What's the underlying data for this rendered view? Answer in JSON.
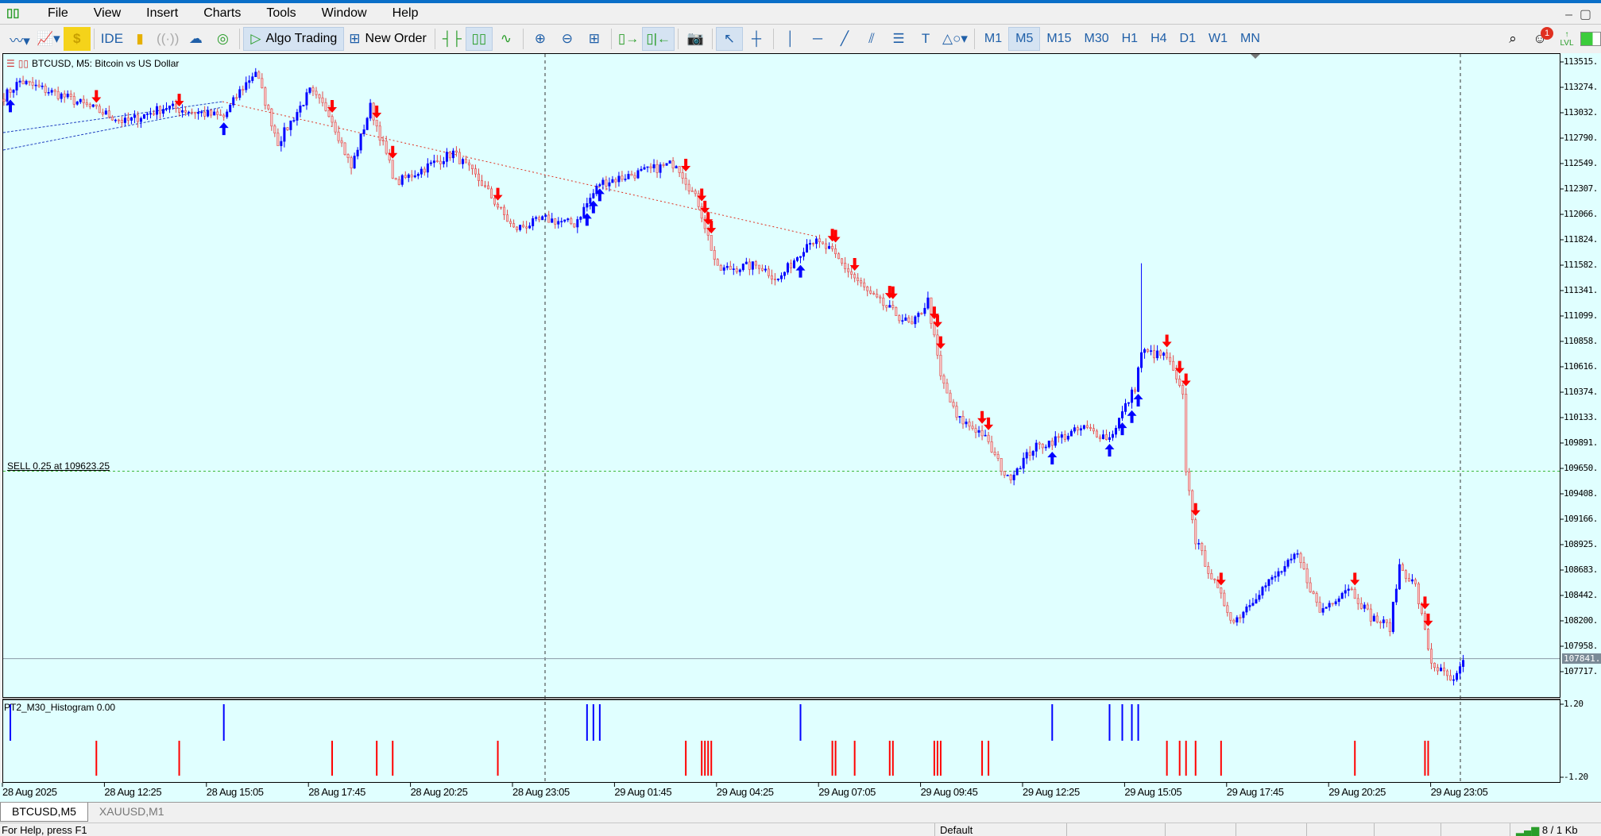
{
  "menu": [
    "File",
    "View",
    "Insert",
    "Charts",
    "Tools",
    "Window",
    "Help"
  ],
  "toolbar": {
    "ide": "IDE",
    "algo_trading": "Algo Trading",
    "new_order": "New Order",
    "timeframes": [
      "M1",
      "M5",
      "M15",
      "M30",
      "H1",
      "H4",
      "D1",
      "W1",
      "MN"
    ],
    "active_timeframe": "M5",
    "notification_count": "1",
    "lvl": "LVL"
  },
  "chart": {
    "title": "BTCUSD, M5:  Bitcoin vs US Dollar",
    "price_ticks": [
      "113515.",
      "113274.",
      "113032.",
      "112790.",
      "112549.",
      "112307.",
      "112066.",
      "111824.",
      "111582.",
      "111341.",
      "111099.",
      "110858.",
      "110616.",
      "110374.",
      "110133.",
      "109891.",
      "109650.",
      "109408.",
      "109166.",
      "108925.",
      "108683.",
      "108442.",
      "108200.",
      "107958.",
      "107717."
    ],
    "price_top": 113515,
    "price_bottom": 107717,
    "current_price": "107841.",
    "current_price_value": 107841,
    "sell_label": "SELL 0.25 at 109623.25",
    "sell_price": 109623.25,
    "time_ticks": [
      "28 Aug 2025",
      "28 Aug 12:25",
      "28 Aug 15:05",
      "28 Aug 17:45",
      "28 Aug 20:25",
      "28 Aug 23:05",
      "29 Aug 01:45",
      "29 Aug 04:25",
      "29 Aug 07:05",
      "29 Aug 09:45",
      "29 Aug 12:25",
      "29 Aug 15:05",
      "29 Aug 17:45",
      "29 Aug 20:25",
      "29 Aug 23:05"
    ],
    "bars_total": 459,
    "close_keypoints": [
      [
        0,
        113185
      ],
      [
        5,
        113331
      ],
      [
        19,
        113185
      ],
      [
        38,
        112943
      ],
      [
        51,
        113088
      ],
      [
        69,
        112991
      ],
      [
        74,
        113234
      ],
      [
        79,
        113428
      ],
      [
        86,
        112749
      ],
      [
        96,
        113234
      ],
      [
        102,
        113040
      ],
      [
        109,
        112506
      ],
      [
        115,
        113088
      ],
      [
        123,
        112361
      ],
      [
        141,
        112652
      ],
      [
        150,
        112361
      ],
      [
        160,
        111924
      ],
      [
        170,
        112021
      ],
      [
        179,
        111973
      ],
      [
        187,
        112361
      ],
      [
        205,
        112506
      ],
      [
        211,
        112555
      ],
      [
        218,
        112167
      ],
      [
        224,
        111536
      ],
      [
        237,
        111585
      ],
      [
        243,
        111439
      ],
      [
        253,
        111827
      ],
      [
        259,
        111730
      ],
      [
        272,
        111294
      ],
      [
        285,
        111003
      ],
      [
        290,
        111245
      ],
      [
        294,
        110518
      ],
      [
        299,
        110130
      ],
      [
        307,
        109984
      ],
      [
        315,
        109548
      ],
      [
        323,
        109839
      ],
      [
        339,
        110033
      ],
      [
        347,
        109936
      ],
      [
        355,
        110421
      ],
      [
        357,
        110760
      ],
      [
        365,
        110712
      ],
      [
        370,
        110324
      ],
      [
        371,
        109645
      ],
      [
        374,
        108966
      ],
      [
        381,
        108481
      ],
      [
        386,
        108190
      ],
      [
        394,
        108481
      ],
      [
        406,
        108821
      ],
      [
        413,
        108287
      ],
      [
        422,
        108530
      ],
      [
        429,
        108238
      ],
      [
        435,
        108141
      ],
      [
        438,
        108723
      ],
      [
        443,
        108530
      ],
      [
        448,
        107802
      ],
      [
        455,
        107608
      ],
      [
        458,
        107802
      ]
    ],
    "spike": {
      "bar": 357,
      "high": 111600
    },
    "sell_signals": [
      29,
      55,
      103,
      117,
      122,
      155,
      214,
      219,
      220,
      221,
      222,
      260,
      261,
      267,
      278,
      279,
      292,
      293,
      294,
      307,
      309,
      365,
      369,
      371,
      374,
      382,
      424,
      446,
      447
    ],
    "buy_signals": [
      2,
      69,
      183,
      185,
      187,
      250,
      329,
      347,
      351,
      354,
      356
    ]
  },
  "indicator": {
    "label": "PT2_M30_Histogram 0.00",
    "max_label": "1.20",
    "min_label": "-1.20",
    "max": 1.2,
    "min": -1.2
  },
  "tabs": [
    "BTCUSD,M5",
    "XAUUSD,M1"
  ],
  "status": {
    "help": "For Help, press F1",
    "profile": "Default",
    "traffic": "8 / 1 Kb"
  },
  "colors": {
    "bull": "#0000ff",
    "bear": "#e04848",
    "chart_bg": "#e0ffff",
    "sell_arrow": "#ff0000",
    "buy_arrow": "#0000ff"
  }
}
